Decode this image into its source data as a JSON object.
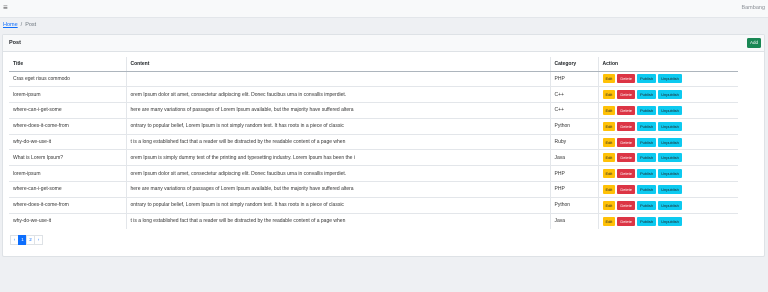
{
  "topbar": {
    "menu_icon": "hamburger-icon",
    "user_name": "Bambang"
  },
  "breadcrumb": {
    "home": "Home",
    "separator": "/",
    "current": "Post"
  },
  "card": {
    "title": "Post",
    "add_label": "Add"
  },
  "table": {
    "headers": {
      "title": "Title",
      "content": "Content",
      "category": "Category",
      "action": "Action"
    },
    "actions": {
      "edit": "Edit",
      "delete": "Delete",
      "publish": "Publish",
      "unpublish": "Unpublish"
    },
    "rows": [
      {
        "title": "Cras eget risus commodo",
        "content": "",
        "category": "PHP"
      },
      {
        "title": "lorem-ipsum",
        "content": "orem Ipsum dolor sit amet, consectetur adipiscing elit. Donec faucibus urna in convallis imperdiet.",
        "category": "C++"
      },
      {
        "title": "where-can-i-get-some",
        "content": "here are many variations of passages of Lorem Ipsum available, but the majority have suffered altera",
        "category": "C++"
      },
      {
        "title": "where-does-it-come-from",
        "content": "ontrary to popular belief, Lorem Ipsum is not simply random text. It has roots in a piece of classic",
        "category": "Python"
      },
      {
        "title": "why-do-we-use-it",
        "content": "t is a long established fact that a reader will be distracted by the readable content of a page when",
        "category": "Ruby"
      },
      {
        "title": "What is Lorem Ipsum?",
        "content": "orem Ipsum is simply dummy text of the printing and typesetting industry. Lorem Ipsum has been the i",
        "category": "Java"
      },
      {
        "title": "lorem-ipsum",
        "content": "orem Ipsum dolor sit amet, consectetur adipiscing elit. Donec faucibus urna in convallis imperdiet.",
        "category": "PHP"
      },
      {
        "title": "where-can-i-get-some",
        "content": "here are many variations of passages of Lorem Ipsum available, but the majority have suffered altera",
        "category": "PHP"
      },
      {
        "title": "where-does-it-come-from",
        "content": "ontrary to popular belief, Lorem Ipsum is not simply random text. It has roots in a piece of classic",
        "category": "Python"
      },
      {
        "title": "why-do-we-use-it",
        "content": "t is a long established fact that a reader will be distracted by the readable content of a page when",
        "category": "Java"
      }
    ]
  },
  "pagination": {
    "prev": "‹",
    "pages": [
      "1",
      "2"
    ],
    "active": "1",
    "next": "›"
  },
  "colors": {
    "add": "#198754",
    "edit": "#ffc107",
    "delete": "#dc3545",
    "publish": "#0dcaf0",
    "active_page": "#0d6efd"
  }
}
